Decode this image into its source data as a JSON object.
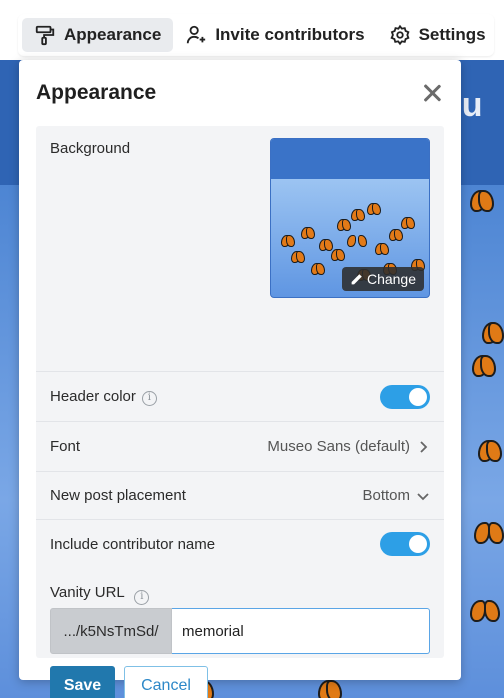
{
  "tabs": [
    {
      "label": "Appearance",
      "icon": "paint-roller-icon",
      "active": true
    },
    {
      "label": "Invite contributors",
      "icon": "add-user-icon",
      "active": false
    },
    {
      "label": "Settings",
      "icon": "gear-icon",
      "active": false
    }
  ],
  "modal": {
    "title": "Appearance",
    "background": {
      "label": "Background",
      "change_label": "Change"
    },
    "header_color": {
      "label": "Header color",
      "enabled": true
    },
    "font": {
      "label": "Font",
      "value": "Museo Sans (default)"
    },
    "post_placement": {
      "label": "New post placement",
      "value": "Bottom"
    },
    "contributor_name": {
      "label": "Include contributor name",
      "enabled": true
    },
    "vanity_url": {
      "label": "Vanity URL",
      "prefix": ".../k5NsTmSd/",
      "value": "memorial"
    },
    "save_label": "Save",
    "cancel_label": "Cancel"
  },
  "colors": {
    "accent": "#2d9fe6",
    "primary_button": "#2178ad",
    "header_blue": "#3a73c8"
  }
}
